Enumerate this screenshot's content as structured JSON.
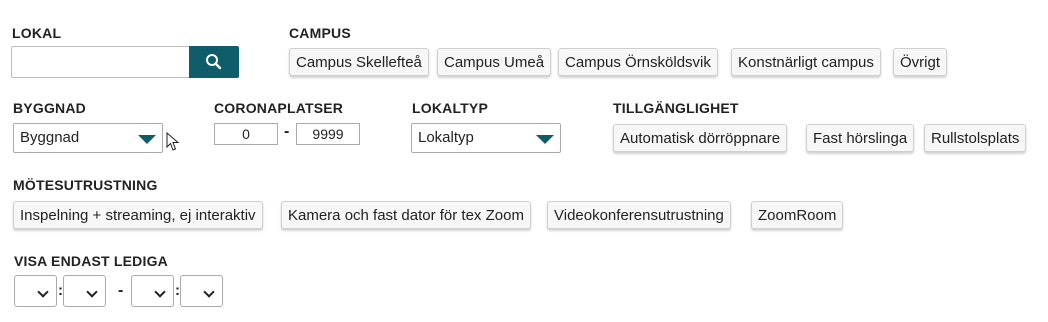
{
  "lokal": {
    "label": "LOKAL",
    "search_value": ""
  },
  "campus": {
    "label": "CAMPUS",
    "options": [
      "Campus Skellefteå",
      "Campus Umeå",
      "Campus Örnsköldsvik",
      "Konstnärligt campus",
      "Övrigt"
    ]
  },
  "byggnad": {
    "label": "BYGGNAD",
    "selected": "Byggnad"
  },
  "coronaplatser": {
    "label": "CORONAPLATSER",
    "min": "0",
    "separator": "-",
    "max": "9999"
  },
  "lokaltyp": {
    "label": "LOKALTYP",
    "selected": "Lokaltyp"
  },
  "tillganglighet": {
    "label": "TILLGÄNGLIGHET",
    "options": [
      "Automatisk dörröppnare",
      "Fast hörslinga",
      "Rullstolsplats"
    ]
  },
  "motesutrustning": {
    "label": "MÖTESUTRUSTNING",
    "options": [
      "Inspelning + streaming, ej interaktiv",
      "Kamera och fast dator för tex Zoom",
      "Videokonferensutrustning",
      "ZoomRoom"
    ]
  },
  "visa_endast_lediga": {
    "label": "VISA ENDAST LEDIGA",
    "colon": ":",
    "separator": "-"
  },
  "colors": {
    "accent": "#0f5c6b"
  }
}
